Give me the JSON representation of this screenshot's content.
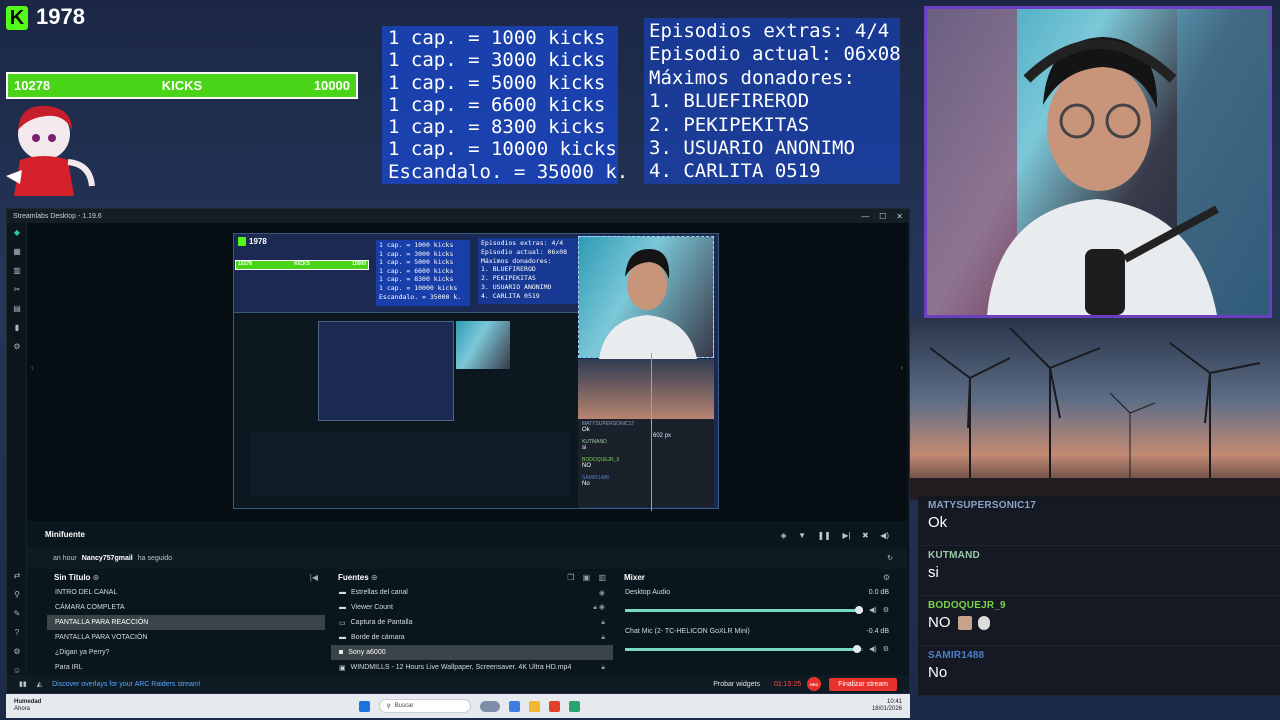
{
  "overlay": {
    "kick_count": "1978",
    "kick_logo": "K",
    "goal": {
      "current": "10278",
      "label": "KICKS",
      "target": "10000",
      "progress": 1.0
    },
    "price_list": [
      "1 cap. = 1000 kicks",
      "1 cap. = 3000 kicks",
      "1 cap. = 5000 kicks",
      "1 cap. = 6600 kicks",
      "1 cap. = 8300 kicks",
      "1 cap. = 10000 kicks",
      "Escandalo. = 35000 k."
    ],
    "info": [
      "Episodios extras: 4/4",
      "Episodio actual: 06x08",
      "Máximos donadores:",
      "1. BLUEFIREROD",
      "2. PEKIPEKITAS",
      "3. USUARIO ANONIMO",
      "4. CARLITA 0519"
    ]
  },
  "chat": [
    {
      "user": "MATYSUPERSONIC17",
      "text": "Ok",
      "color": "#8aa3c7"
    },
    {
      "user": "KUTMAND",
      "text": "si",
      "color": "#9cc9a6"
    },
    {
      "user": "BODOQUEJR_9",
      "text": "NO",
      "color": "#7ad34b"
    },
    {
      "user": "SAMIR1488",
      "text": "No",
      "color": "#4f7fd0"
    }
  ],
  "streamlabs": {
    "title": "Streamlabs Desktop - 1.19.6",
    "preview_px_label": "602 px",
    "minifuente": {
      "title": "Minifuente"
    },
    "activity": {
      "time": "an hour",
      "user": "Nancy757gmail",
      "action": "ha seguido"
    },
    "scenes": {
      "title": "Sin Título",
      "items": [
        "INTRO DEL CANAL",
        "CÁMARA COMPLETA",
        "PANTALLA PARA REACCIÓN",
        "PANTALLA PARA VOTACIÓN",
        "¿Digan ya Perry?",
        "Para IRL"
      ],
      "selected_index": 2
    },
    "sources": {
      "title": "Fuentes",
      "items": [
        {
          "label": "Estrellas del canal",
          "icon": "folder-icon"
        },
        {
          "label": "Viewer Count",
          "icon": "folder-icon"
        },
        {
          "label": "Captura de Pantalla",
          "icon": "monitor-icon"
        },
        {
          "label": "Borde de cámara",
          "icon": "folder-icon"
        },
        {
          "label": "Sony a6000",
          "icon": "camera-icon"
        },
        {
          "label": "WINDMILLS - 12 Hours Live Wallpaper, Screensaver. 4K Ultra HD.mp4",
          "icon": "video-icon"
        }
      ],
      "selected_index": 4
    },
    "mixer": {
      "title": "Mixer",
      "items": [
        {
          "name": "Desktop Audio",
          "db": "0.0 dB",
          "level": 1.0
        },
        {
          "name": "Chat Mic (2- TC-HELICON GoXLR Mini)",
          "db": "-0.4 dB",
          "level": 0.99
        }
      ]
    },
    "status": {
      "promo": "Discover overlays for your ARC Raiders stream!",
      "widgets": "Probar widgets",
      "timer": "01:15:25",
      "rec": "REC",
      "end": "Finalizar stream"
    }
  },
  "taskbar": {
    "weather_title": "Humedad",
    "weather_sub": "Ahora",
    "search_placeholder": "Buscar",
    "time": "10:41",
    "date": "18/01/2026"
  }
}
